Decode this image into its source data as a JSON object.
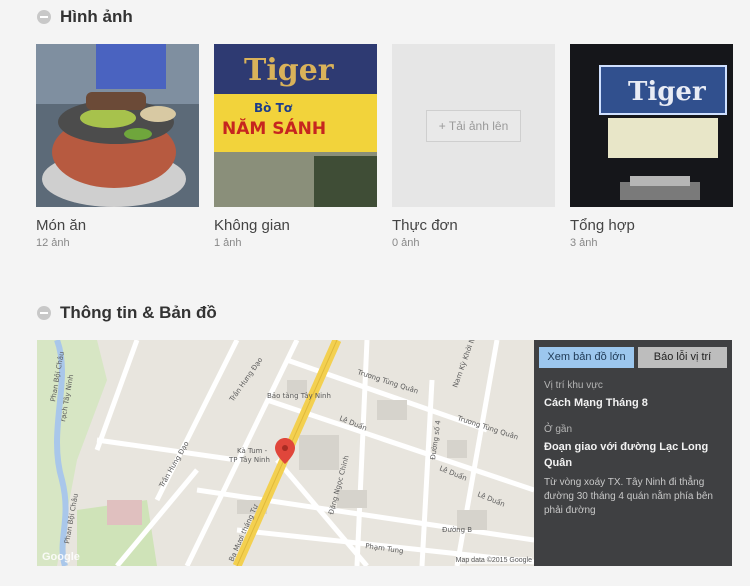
{
  "images_section": {
    "title": "Hình ảnh"
  },
  "photos": [
    {
      "category": "Món ăn",
      "count": "12 ảnh"
    },
    {
      "category": "Không gian",
      "count": "1 ảnh"
    },
    {
      "category": "Thực đơn",
      "count": "0 ảnh",
      "upload_label": "+ Tải ảnh lên"
    },
    {
      "category": "Tổng hợp",
      "count": "3 ảnh"
    }
  ],
  "info_section": {
    "title": "Thông tin & Bản đồ"
  },
  "map_panel": {
    "view_large_label": "Xem bản đồ lớn",
    "report_label": "Báo lỗi vị trí",
    "area_label": "Vị trí khu vực",
    "area_value": "Cách Mạng Tháng 8",
    "near_label": "Ở gần",
    "near_value": "Đoạn giao với đường Lạc Long Quân",
    "directions": "Từ vòng xoáy TX. Tây Ninh đi thẳng đường 30 tháng 4 quán nằm phía bên phải đường"
  },
  "map": {
    "attribution": "Map data ©2015 Google",
    "google": "Google",
    "labels": {
      "bao_tang": "Bảo tàng Tây Ninh",
      "truong_tung_quan": "Trương Tùng Quân",
      "truong_tung_quan2": "Trương Tùng Quân",
      "nam_ky": "Nam Kỳ Khởi Nghĩa",
      "le_duan": "Lê Duẩn",
      "le_duan2": "Lê Duẩn",
      "le_duan3": "Lê Duẩn",
      "duong_so4": "Đường số 4",
      "tran_hung_dao": "Trần Hưng Đạo",
      "tran_hung_dao2": "Trần Hưng Đạo",
      "ka_tum": "Kà Tum -",
      "tp_tay_ninh": "TP Tây Ninh",
      "dang_ngoc_chinh": "Đặng Ngọc Chinh",
      "ba_muoi": "Ba Mươi tháng Tư",
      "pham_tung": "Phạm Tung",
      "duong_b": "Đường B",
      "rach_tay_ninh": "rạch Tây Ninh",
      "phan_boi_chau": "Phan Bội Châu",
      "phan_boi_chau2": "Phan Bội Châu"
    }
  }
}
